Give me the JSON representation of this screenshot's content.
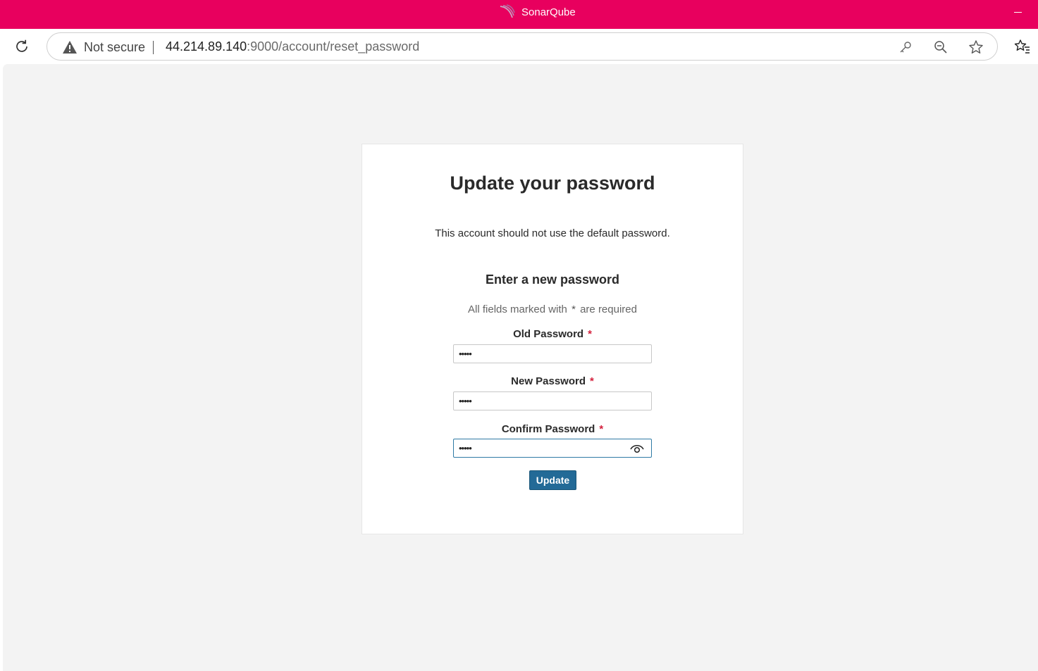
{
  "window": {
    "title": "SonarQube",
    "accent_color": "#e8005e"
  },
  "browser": {
    "security_label": "Not secure",
    "url_host": "44.214.89.140",
    "url_rest": ":9000/account/reset_password",
    "icons": [
      "reload-icon",
      "warning-icon",
      "key-icon",
      "zoom-out-icon",
      "star-icon",
      "favorites-icon"
    ]
  },
  "card": {
    "heading": "Update your password",
    "warning_text": "This account should not use the default password.",
    "subheading": "Enter a new password",
    "required_note_prefix": "All fields marked with",
    "required_note_star": "*",
    "required_note_suffix": "are required"
  },
  "fields": {
    "old_password": {
      "label": "Old Password",
      "required_mark": "*",
      "value": "•••••"
    },
    "new_password": {
      "label": "New Password",
      "required_mark": "*",
      "value": "•••••"
    },
    "confirm_password": {
      "label": "Confirm Password",
      "required_mark": "*",
      "value": "•••••"
    }
  },
  "update_button": {
    "label": "Update",
    "color": "#236a97"
  }
}
